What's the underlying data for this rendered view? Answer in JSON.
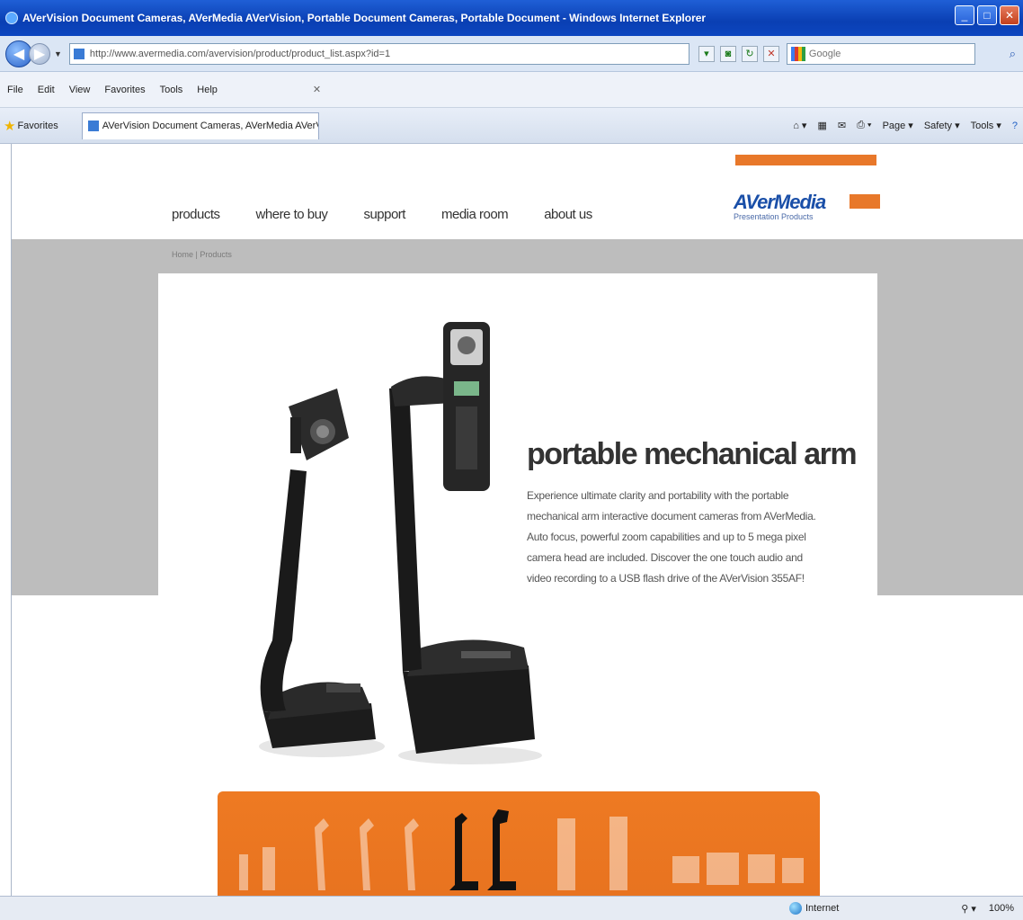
{
  "window": {
    "title": "AVerVision Document Cameras, AVerMedia AVerVision, Portable Document Cameras, Portable Document - Windows Internet Explorer",
    "min_label": "_",
    "max_label": "□",
    "close_label": "✕"
  },
  "address": {
    "url": "http://www.avermedia.com/avervision/product/product_list.aspx?id=1",
    "search_placeholder": "Google"
  },
  "menu": {
    "items": [
      "File",
      "Edit",
      "View",
      "Favorites",
      "Tools",
      "Help"
    ],
    "x_label": "✕"
  },
  "favorites": {
    "label": "Favorites",
    "tab_title": "AVerVision Document Cameras, AVerMedia AVerVision...",
    "page_label": "Page ▾",
    "safety_label": "Safety ▾",
    "tools_label": "Tools ▾"
  },
  "site": {
    "nav": [
      "products",
      "where to buy",
      "support",
      "media room",
      "about us"
    ],
    "logo": "AVerMedia",
    "logo_sub": "Presentation Products",
    "breadcrumb": "Home | Products",
    "hero_title": "portable mechanical arm",
    "hero_body": "Experience ultimate clarity and portability with the portable mechanical arm interactive document cameras from AVerMedia. Auto focus, powerful zoom capabilities and up to 5 mega pixel camera head are included. Discover the one touch audio and video recording to a USB flash drive of the AVerVision 355AF!"
  },
  "status": {
    "zone": "Internet",
    "zoom": "100%"
  },
  "colors": {
    "accent_orange": "#e8782a",
    "brand_blue": "#1a4fa8",
    "band_gray": "#bdbdbd"
  }
}
